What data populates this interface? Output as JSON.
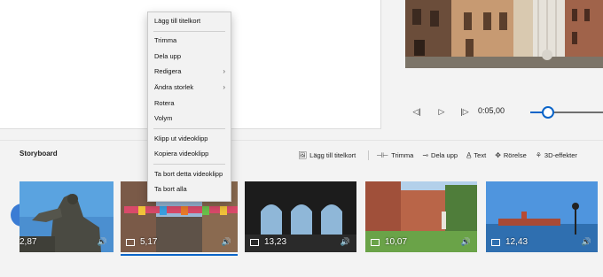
{
  "context_menu": {
    "items": [
      {
        "label": "Lägg till titelkort"
      },
      {
        "label": "Trimma"
      },
      {
        "label": "Dela upp"
      },
      {
        "label": "Redigera",
        "submenu": true
      },
      {
        "label": "Ändra storlek",
        "submenu": true
      },
      {
        "label": "Rotera"
      },
      {
        "label": "Volym"
      },
      {
        "label": "Klipp ut videoklipp"
      },
      {
        "label": "Kopiera videoklipp"
      },
      {
        "label": "Ta bort detta videoklipp"
      },
      {
        "label": "Ta bort alla"
      }
    ]
  },
  "player": {
    "time": "0:05,00",
    "progress": 0.24
  },
  "storyboard": {
    "title": "Storyboard",
    "tools": {
      "add_title_card": "Lägg till titelkort",
      "trim": "Trimma",
      "split": "Dela upp",
      "text": "Text",
      "motion": "Rörelse",
      "effects_3d": "3D-effekter"
    },
    "clips": [
      {
        "duration": "2,87",
        "selected": false
      },
      {
        "duration": "5,17",
        "selected": true
      },
      {
        "duration": "13,23",
        "selected": false
      },
      {
        "duration": "10,07",
        "selected": false
      },
      {
        "duration": "12,43",
        "selected": false
      }
    ]
  },
  "colors": {
    "accent": "#0a64c8",
    "nav_button": "#3b7cd4"
  }
}
